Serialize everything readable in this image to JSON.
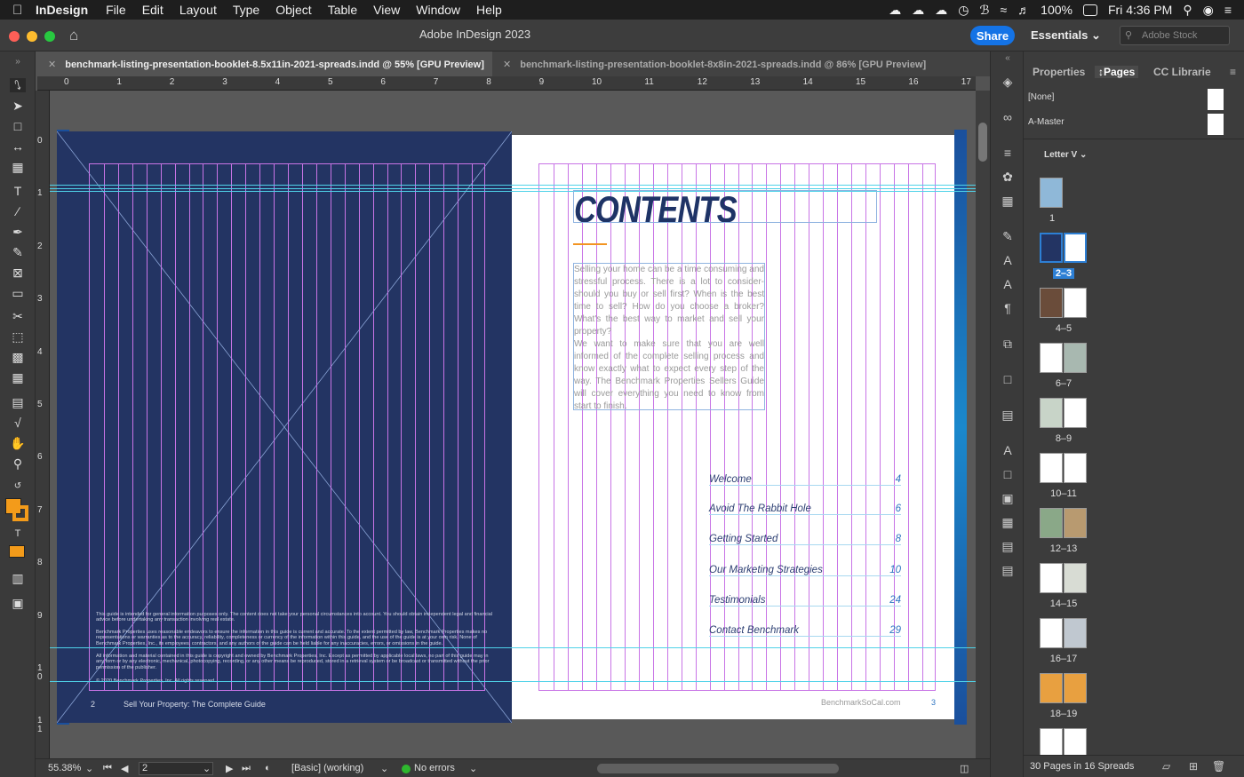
{
  "menubar": {
    "app": "InDesign",
    "items": [
      "File",
      "Edit",
      "Layout",
      "Type",
      "Object",
      "Table",
      "View",
      "Window",
      "Help"
    ],
    "battery": "100%",
    "clock": "Fri 4:36 PM"
  },
  "titlebar": {
    "title": "Adobe InDesign 2023",
    "share": "Share",
    "workspace": "Essentials",
    "stock_placeholder": "Adobe Stock"
  },
  "tabs": [
    {
      "label": "benchmark-listing-presentation-booklet-8.5x11in-2021-spreads.indd @ 55% [GPU Preview]",
      "active": true
    },
    {
      "label": "benchmark-listing-presentation-booklet-8x8in-2021-spreads.indd @ 86% [GPU Preview]",
      "active": false
    }
  ],
  "ruler": {
    "h": [
      "0",
      "1",
      "2",
      "3",
      "4",
      "5",
      "6",
      "7",
      "8",
      "9",
      "10",
      "11",
      "12",
      "13",
      "14",
      "15",
      "16",
      "17"
    ],
    "v": [
      "0",
      "1",
      "2",
      "3",
      "4",
      "5",
      "6",
      "7",
      "8",
      "9",
      "1\n0",
      "1\n1"
    ]
  },
  "document": {
    "title": "CONTENTS",
    "para1": "Selling your home can be a time consuming and stressful process. There is a lot to consider- should you buy or sell first? When is the best time to sell? How do you choose a broker? What's the best way to market and sell your property?",
    "para2": "We want to make sure that you are well informed of the complete selling process and know exactly what to expect every step of the way. The Benchmark Properties Sellers Guide will cover everything you need to know from start to finish.",
    "toc": [
      {
        "label": "Welcome",
        "page": "4"
      },
      {
        "label": "Avoid The Rabbit Hole",
        "page": "6"
      },
      {
        "label": "Getting Started",
        "page": "8"
      },
      {
        "label": "Our Marketing Strategies",
        "page": "10"
      },
      {
        "label": "Testimonials",
        "page": "24"
      },
      {
        "label": "Contact Benchmark",
        "page": "29"
      }
    ],
    "legal1": "This guide is intended for general information purposes only. The content does not take your personal circumstances into account. You should obtain independent legal and financial advice before undertaking any transaction involving real estate.",
    "legal2": "Benchmark Properties uses reasonable endeavors to ensure the information in this guide is current and accurate. To the extent permitted by law, Benchmark Properties makes no representations or warranties as to the accuracy, reliability, completeness or currency of the information within this guide, and the use of the guide is at your own risk. None of Benchmark Properties, Inc., its employees, contractors, and any authors of the guide can be held liable for any inaccuracies, errors, or omissions in the guide.",
    "legal3": "All information and material contained in this guide is copyright and owned by Benchmark Properties, Inc. Except as permitted by applicable local laws, no part of this guide may in any form or by any electronic, mechanical, photocopying, recording, or any other means be reproduced, stored in a retrieval system or be broadcast or transmitted without the prior permission of the publisher.",
    "legal4": "© 2020 Benchmark Properties, Inc. All rights reserved.",
    "footer_left_num": "2",
    "footer_left_text": "Sell Your Property: The Complete Guide",
    "footer_right_text": "BenchmarkSoCal.com",
    "footer_right_num": "3"
  },
  "statusbar": {
    "zoom": "55.38%",
    "page": "2",
    "style": "[Basic] (working)",
    "errors": "No errors"
  },
  "pages_panel": {
    "tabs": [
      "Properties",
      "Pages",
      "CC Librarie"
    ],
    "masters": [
      "[None]",
      "A-Master"
    ],
    "size": "Letter V",
    "spreads": [
      "1",
      "2–3",
      "4–5",
      "6–7",
      "8–9",
      "10–11",
      "12–13",
      "14–15",
      "16–17",
      "18–19"
    ],
    "footer": "30 Pages in 16 Spreads"
  },
  "colors": {
    "accent": "#1473e6",
    "navy": "#233463",
    "orange": "#f29422",
    "guide": "#c874e6"
  }
}
